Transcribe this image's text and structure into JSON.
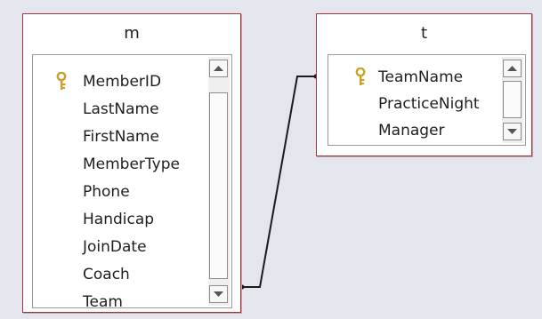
{
  "tables": [
    {
      "id": "m",
      "title": "m",
      "fields": [
        {
          "name": "MemberID",
          "primary_key": true
        },
        {
          "name": "LastName",
          "primary_key": false
        },
        {
          "name": "FirstName",
          "primary_key": false
        },
        {
          "name": "MemberType",
          "primary_key": false
        },
        {
          "name": "Phone",
          "primary_key": false
        },
        {
          "name": "Handicap",
          "primary_key": false
        },
        {
          "name": "JoinDate",
          "primary_key": false
        },
        {
          "name": "Coach",
          "primary_key": false
        },
        {
          "name": "Team",
          "primary_key": false
        }
      ]
    },
    {
      "id": "t",
      "title": "t",
      "fields": [
        {
          "name": "TeamName",
          "primary_key": true
        },
        {
          "name": "PracticeNight",
          "primary_key": false
        },
        {
          "name": "Manager",
          "primary_key": false
        }
      ]
    }
  ],
  "relationship": {
    "from_table": "m",
    "from_field": "Team",
    "to_table": "t",
    "to_field": "TeamName"
  },
  "icons": {
    "key": "key-icon",
    "scroll_up": "scroll-up-arrow-icon",
    "scroll_down": "scroll-down-arrow-icon"
  },
  "colors": {
    "canvas": "#e3e7ed",
    "table_border": "#a2343c",
    "key": "#c9a227",
    "line": "#1a1a1a"
  }
}
